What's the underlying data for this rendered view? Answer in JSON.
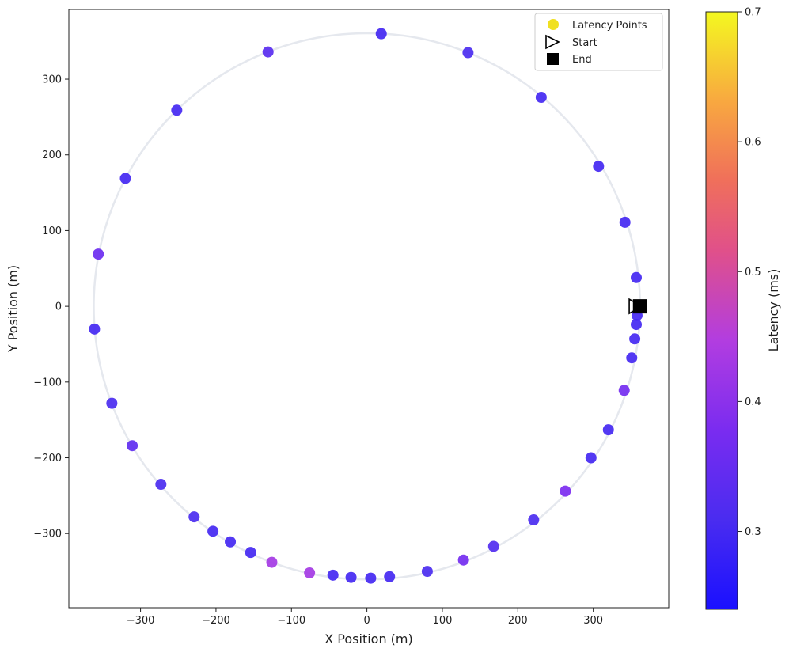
{
  "chart_data": {
    "type": "scatter",
    "xlabel": "X Position (m)",
    "ylabel": "Y Position (m)",
    "colorbar_label": "Latency (ms)",
    "xlim": [
      -395,
      400
    ],
    "ylim": [
      -398,
      392
    ],
    "clim": [
      0.24,
      0.7
    ],
    "xticks": [
      -300,
      -200,
      -100,
      0,
      100,
      200,
      300
    ],
    "yticks": [
      -300,
      -200,
      -100,
      0,
      100,
      200,
      300
    ],
    "xtick_labels": [
      "−300",
      "−200",
      "−100",
      "0",
      "100",
      "200",
      "300"
    ],
    "ytick_labels": [
      "−300",
      "−200",
      "−100",
      "0",
      "100",
      "200",
      "300"
    ],
    "cticks": [
      0.3,
      0.4,
      0.5,
      0.6,
      0.7
    ],
    "ctick_labels": [
      "0.3",
      "0.4",
      "0.5",
      "0.6",
      "0.7"
    ],
    "colormap": "plasma",
    "grid": false,
    "legend": {
      "position": "top-right",
      "entries": [
        {
          "label": "Latency Points",
          "marker": "circle",
          "color": "#f0e020"
        },
        {
          "label": "Start",
          "marker": "triangle-right-open",
          "color": "#000000"
        },
        {
          "label": "End",
          "marker": "square",
          "color": "#000000"
        }
      ]
    },
    "trajectory": {
      "shape": "circle",
      "center": [
        0,
        0
      ],
      "radius": 362,
      "color": "#e5e8ee"
    },
    "points": [
      {
        "x": 19,
        "y": 360,
        "latency": 0.3
      },
      {
        "x": 134,
        "y": 335,
        "latency": 0.31
      },
      {
        "x": 231,
        "y": 276,
        "latency": 0.3
      },
      {
        "x": 307,
        "y": 185,
        "latency": 0.3
      },
      {
        "x": 342,
        "y": 111,
        "latency": 0.3
      },
      {
        "x": 357,
        "y": 38,
        "latency": 0.3
      },
      {
        "x": 358,
        "y": -12,
        "latency": 0.3
      },
      {
        "x": 357,
        "y": -24,
        "latency": 0.3
      },
      {
        "x": 355,
        "y": -43,
        "latency": 0.3
      },
      {
        "x": 351,
        "y": -68,
        "latency": 0.3
      },
      {
        "x": 341,
        "y": -111,
        "latency": 0.37
      },
      {
        "x": 320,
        "y": -163,
        "latency": 0.3
      },
      {
        "x": 297,
        "y": -200,
        "latency": 0.3
      },
      {
        "x": 263,
        "y": -244,
        "latency": 0.38
      },
      {
        "x": 221,
        "y": -282,
        "latency": 0.31
      },
      {
        "x": 168,
        "y": -317,
        "latency": 0.32
      },
      {
        "x": 128,
        "y": -335,
        "latency": 0.37
      },
      {
        "x": 80,
        "y": -350,
        "latency": 0.31
      },
      {
        "x": 30,
        "y": -357,
        "latency": 0.3
      },
      {
        "x": 5,
        "y": -359,
        "latency": 0.3
      },
      {
        "x": -21,
        "y": -358,
        "latency": 0.3
      },
      {
        "x": -45,
        "y": -355,
        "latency": 0.3
      },
      {
        "x": -76,
        "y": -352,
        "latency": 0.43
      },
      {
        "x": -126,
        "y": -338,
        "latency": 0.43
      },
      {
        "x": -154,
        "y": -325,
        "latency": 0.3
      },
      {
        "x": -181,
        "y": -311,
        "latency": 0.3
      },
      {
        "x": -204,
        "y": -297,
        "latency": 0.3
      },
      {
        "x": -229,
        "y": -278,
        "latency": 0.31
      },
      {
        "x": -273,
        "y": -235,
        "latency": 0.31
      },
      {
        "x": -311,
        "y": -184,
        "latency": 0.34
      },
      {
        "x": -338,
        "y": -128,
        "latency": 0.31
      },
      {
        "x": -361,
        "y": -30,
        "latency": 0.3
      },
      {
        "x": -356,
        "y": 69,
        "latency": 0.36
      },
      {
        "x": -320,
        "y": 169,
        "latency": 0.3
      },
      {
        "x": -252,
        "y": 259,
        "latency": 0.3
      },
      {
        "x": -131,
        "y": 336,
        "latency": 0.33
      }
    ],
    "start": {
      "x": 355,
      "y": 0
    },
    "end": {
      "x": 362,
      "y": 0
    }
  }
}
